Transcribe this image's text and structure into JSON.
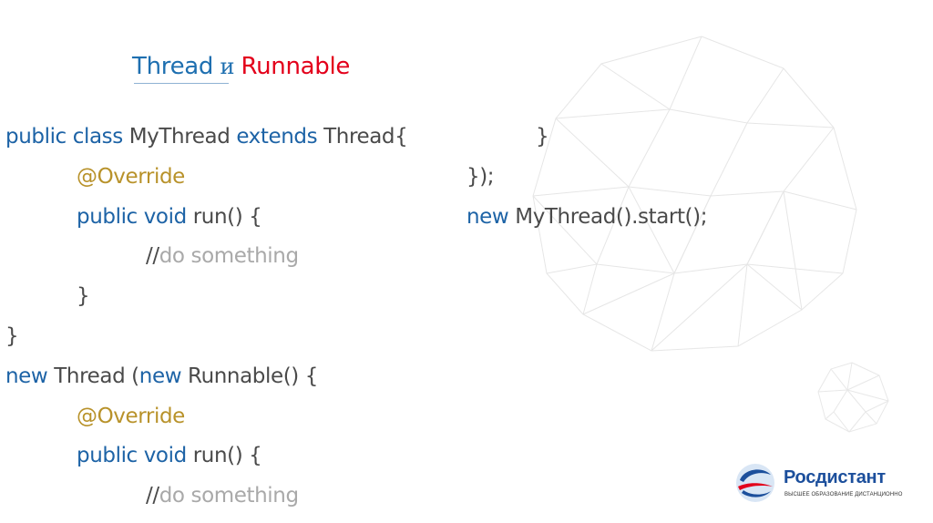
{
  "title": {
    "part1": "Thread",
    "part2": " и ",
    "part3": "Runnable"
  },
  "code_left": {
    "l1": {
      "kw": "public class",
      "t1": " MyThread ",
      "kw2": "extends",
      "t2": " Thread{"
    },
    "l2": {
      "ann": "@Override"
    },
    "l3": {
      "kw": "public void",
      "t": " run() {"
    },
    "l4": {
      "slashes": "//",
      "cmt": "do something"
    },
    "l5": {
      "t": "}"
    },
    "l6": {
      "t": "}"
    },
    "l7": {
      "kw": "new",
      "t1": " Thread (",
      "kw2": "new",
      "t2": " Runnable() {"
    },
    "l8": {
      "ann": "@Override"
    },
    "l9": {
      "kw": "public void",
      "t": " run() {"
    },
    "l10": {
      "slashes": "//",
      "cmt": "do something"
    }
  },
  "code_right": {
    "r1": {
      "t": "}"
    },
    "r2": {
      "t": "});"
    },
    "r3": {
      "kw": "new",
      "t": " MyThread().start();"
    }
  },
  "logo": {
    "name": "Росдистант",
    "tagline": "ВЫСШЕЕ ОБРАЗОВАНИЕ ДИСТАНЦИОННО"
  },
  "colors": {
    "keyword": "#1d63a6",
    "annotation": "#b8922a",
    "comment": "#a9a9a9",
    "title_blue": "#1e6fb0",
    "title_red": "#e3001b",
    "brand": "#1c4f9c"
  }
}
